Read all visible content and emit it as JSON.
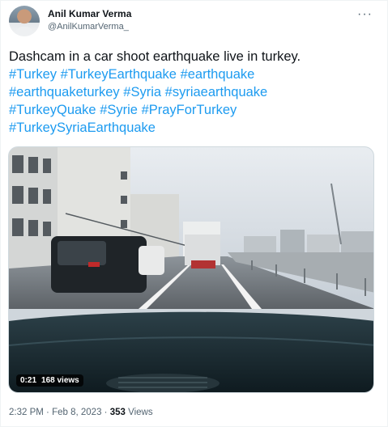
{
  "author": {
    "name": "Anil Kumar Verma",
    "handle": "@AnilKumarVerma_"
  },
  "tweet": {
    "text": "Dashcam in a car shoot earthquake live in turkey.",
    "hashtags": [
      "#Turkey",
      "#TurkeyEarthquake",
      "#earthquake",
      "#earthquaketurkey",
      "#Syria",
      "#syriaearthquake",
      "#TurkeyQuake",
      "#Syrie",
      "#PrayForTurkey",
      "#TurkeySyriaEarthquake"
    ]
  },
  "media": {
    "duration": "0:21",
    "views": "168 views"
  },
  "meta": {
    "time": "2:32 PM",
    "separator": "·",
    "date": "Feb 8, 2023",
    "view_count": "353",
    "view_label": "Views"
  },
  "icons": {
    "more": "more-options-icon",
    "play": "video-badge"
  },
  "colors": {
    "hashtag": "#1d9bf0",
    "text": "#0f1419",
    "secondary": "#536471"
  }
}
